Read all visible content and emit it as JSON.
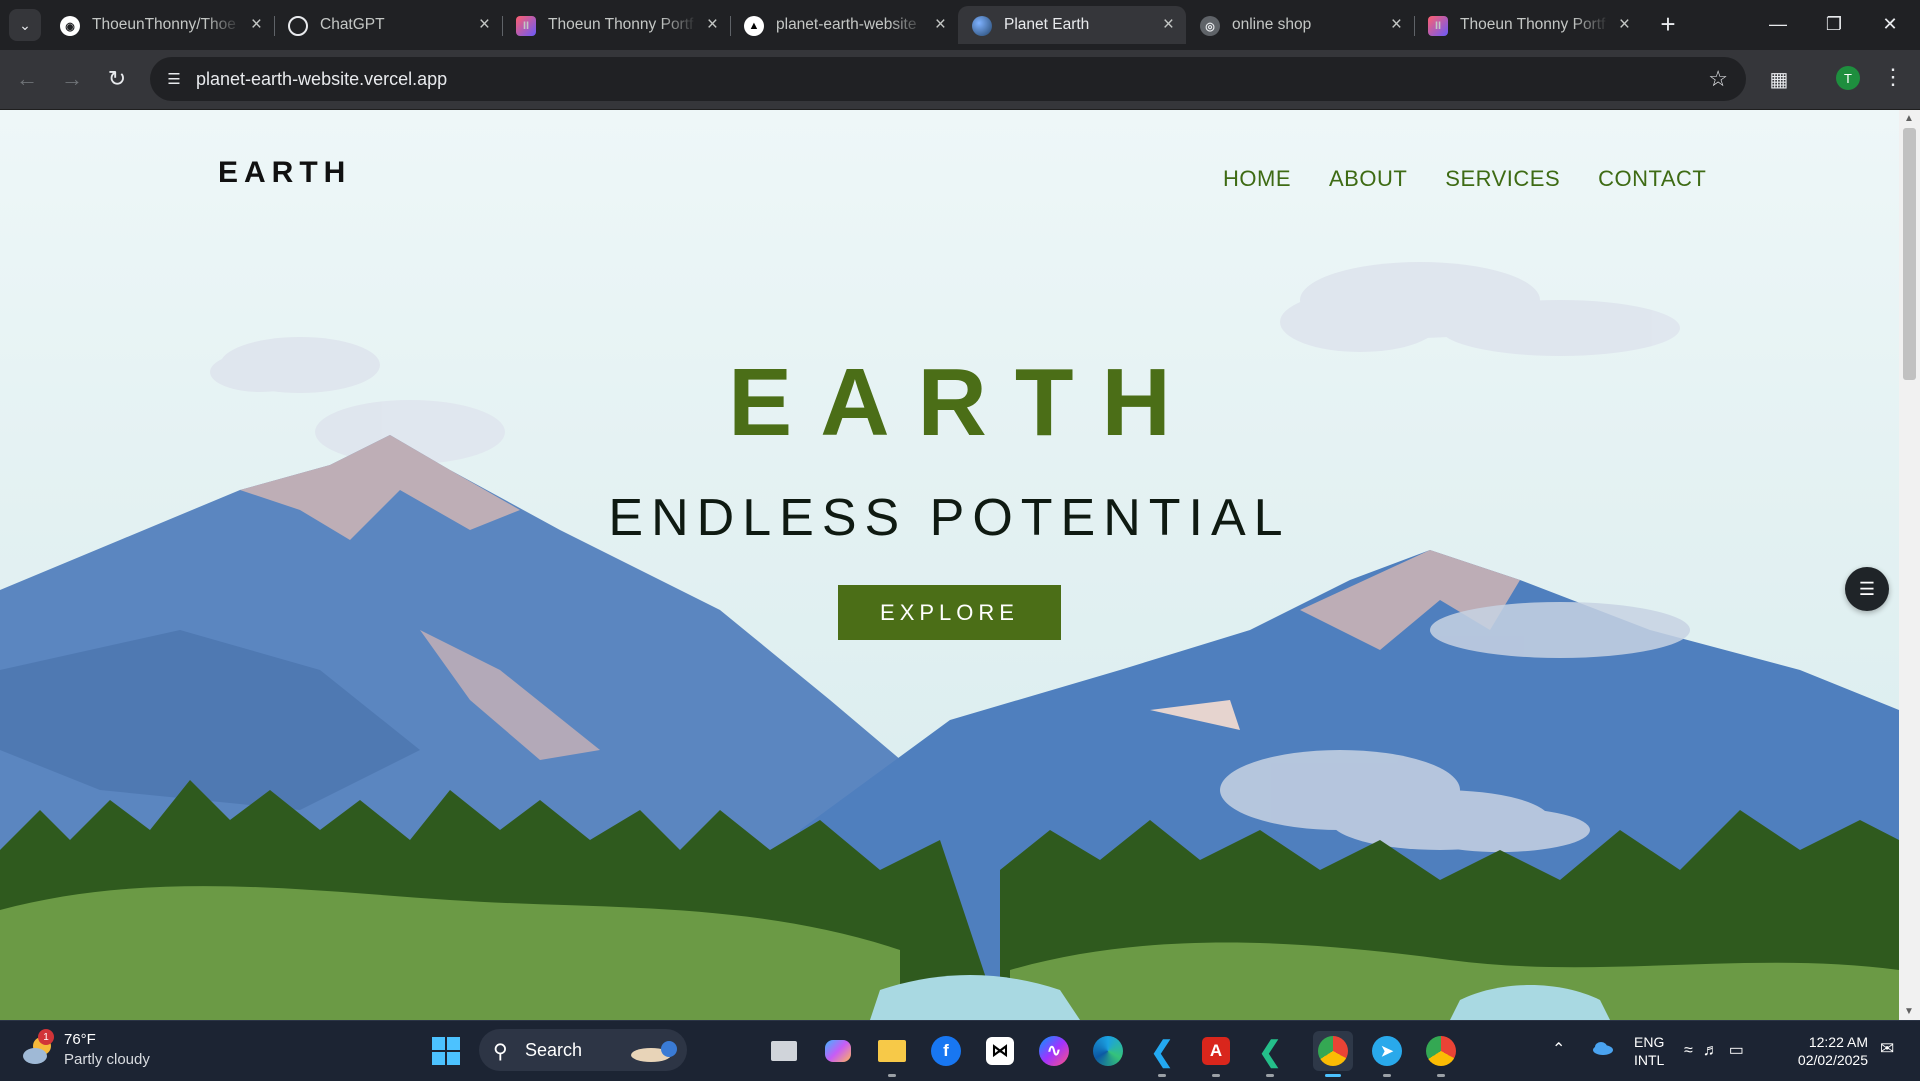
{
  "browser": {
    "tabs": [
      {
        "title": "ThoeunThonny/Thoe",
        "favicon": "github-icon",
        "active": false
      },
      {
        "title": "ChatGPT",
        "favicon": "chatgpt-icon",
        "active": false
      },
      {
        "title": "Thoeun Thonny Portf",
        "favicon": "portfolio-icon",
        "active": false
      },
      {
        "title": "planet-earth-website",
        "favicon": "vercel-icon",
        "active": false
      },
      {
        "title": "Planet Earth",
        "favicon": "planet-icon",
        "active": true
      },
      {
        "title": "online shop",
        "favicon": "globe-icon",
        "active": false
      },
      {
        "title": "Thoeun Thonny Portf",
        "favicon": "portfolio-icon",
        "active": false
      }
    ],
    "url": "planet-earth-website.vercel.app",
    "profile_initial": "T"
  },
  "page": {
    "logo": "EARTH",
    "nav": [
      "HOME",
      "ABOUT",
      "SERVICES",
      "CONTACT"
    ],
    "hero_title": "EARTH",
    "hero_subtitle": "ENDLESS POTENTIAL",
    "cta": "EXPLORE"
  },
  "colors": {
    "accent_green": "#4b6e17",
    "nav_green": "#3e6b14",
    "sky": "#e3f1f2",
    "mountain_blue": "#5b86c0",
    "forest_dark": "#2f5a1e",
    "lake": "#a9d9e2"
  },
  "taskbar": {
    "weather_temp": "76°F",
    "weather_condition": "Partly cloudy",
    "weather_badge": "1",
    "search_label": "Search",
    "apps": [
      "task-view-icon",
      "copilot-icon",
      "file-explorer-icon",
      "facebook-icon",
      "capcut-icon",
      "messenger-icon",
      "edge-icon",
      "vscode-icon",
      "acrobat-icon",
      "vscode-insiders-icon",
      "chrome-icon",
      "telegram-icon",
      "chrome-profile-icon"
    ],
    "language_1": "ENG",
    "language_2": "INTL",
    "time": "12:22 AM",
    "date": "02/02/2025"
  }
}
